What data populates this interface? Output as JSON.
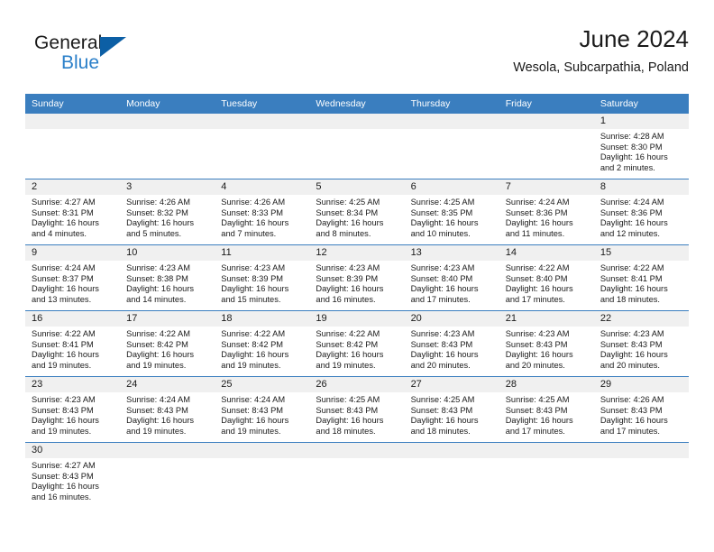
{
  "brand": {
    "name_part1": "General",
    "name_part2": "Blue",
    "logo_icon": "triangle-icon",
    "accent_color": "#0c5fa5",
    "secondary_color": "#2a7fc9"
  },
  "header": {
    "title": "June 2024",
    "subtitle": "Wesola, Subcarpathia, Poland"
  },
  "theme": {
    "header_bg": "#3a7ebf",
    "daynum_bg": "#f0f0f0",
    "row_divider": "#3a7ebf",
    "text": "#1a1a1a"
  },
  "columns": [
    "Sunday",
    "Monday",
    "Tuesday",
    "Wednesday",
    "Thursday",
    "Friday",
    "Saturday"
  ],
  "weeks": [
    [
      {
        "day": "",
        "empty": true
      },
      {
        "day": "",
        "empty": true
      },
      {
        "day": "",
        "empty": true
      },
      {
        "day": "",
        "empty": true
      },
      {
        "day": "",
        "empty": true
      },
      {
        "day": "",
        "empty": true
      },
      {
        "day": "1",
        "sunrise": "Sunrise: 4:28 AM",
        "sunset": "Sunset: 8:30 PM",
        "daylight1": "Daylight: 16 hours",
        "daylight2": "and 2 minutes."
      }
    ],
    [
      {
        "day": "2",
        "sunrise": "Sunrise: 4:27 AM",
        "sunset": "Sunset: 8:31 PM",
        "daylight1": "Daylight: 16 hours",
        "daylight2": "and 4 minutes."
      },
      {
        "day": "3",
        "sunrise": "Sunrise: 4:26 AM",
        "sunset": "Sunset: 8:32 PM",
        "daylight1": "Daylight: 16 hours",
        "daylight2": "and 5 minutes."
      },
      {
        "day": "4",
        "sunrise": "Sunrise: 4:26 AM",
        "sunset": "Sunset: 8:33 PM",
        "daylight1": "Daylight: 16 hours",
        "daylight2": "and 7 minutes."
      },
      {
        "day": "5",
        "sunrise": "Sunrise: 4:25 AM",
        "sunset": "Sunset: 8:34 PM",
        "daylight1": "Daylight: 16 hours",
        "daylight2": "and 8 minutes."
      },
      {
        "day": "6",
        "sunrise": "Sunrise: 4:25 AM",
        "sunset": "Sunset: 8:35 PM",
        "daylight1": "Daylight: 16 hours",
        "daylight2": "and 10 minutes."
      },
      {
        "day": "7",
        "sunrise": "Sunrise: 4:24 AM",
        "sunset": "Sunset: 8:36 PM",
        "daylight1": "Daylight: 16 hours",
        "daylight2": "and 11 minutes."
      },
      {
        "day": "8",
        "sunrise": "Sunrise: 4:24 AM",
        "sunset": "Sunset: 8:36 PM",
        "daylight1": "Daylight: 16 hours",
        "daylight2": "and 12 minutes."
      }
    ],
    [
      {
        "day": "9",
        "sunrise": "Sunrise: 4:24 AM",
        "sunset": "Sunset: 8:37 PM",
        "daylight1": "Daylight: 16 hours",
        "daylight2": "and 13 minutes."
      },
      {
        "day": "10",
        "sunrise": "Sunrise: 4:23 AM",
        "sunset": "Sunset: 8:38 PM",
        "daylight1": "Daylight: 16 hours",
        "daylight2": "and 14 minutes."
      },
      {
        "day": "11",
        "sunrise": "Sunrise: 4:23 AM",
        "sunset": "Sunset: 8:39 PM",
        "daylight1": "Daylight: 16 hours",
        "daylight2": "and 15 minutes."
      },
      {
        "day": "12",
        "sunrise": "Sunrise: 4:23 AM",
        "sunset": "Sunset: 8:39 PM",
        "daylight1": "Daylight: 16 hours",
        "daylight2": "and 16 minutes."
      },
      {
        "day": "13",
        "sunrise": "Sunrise: 4:23 AM",
        "sunset": "Sunset: 8:40 PM",
        "daylight1": "Daylight: 16 hours",
        "daylight2": "and 17 minutes."
      },
      {
        "day": "14",
        "sunrise": "Sunrise: 4:22 AM",
        "sunset": "Sunset: 8:40 PM",
        "daylight1": "Daylight: 16 hours",
        "daylight2": "and 17 minutes."
      },
      {
        "day": "15",
        "sunrise": "Sunrise: 4:22 AM",
        "sunset": "Sunset: 8:41 PM",
        "daylight1": "Daylight: 16 hours",
        "daylight2": "and 18 minutes."
      }
    ],
    [
      {
        "day": "16",
        "sunrise": "Sunrise: 4:22 AM",
        "sunset": "Sunset: 8:41 PM",
        "daylight1": "Daylight: 16 hours",
        "daylight2": "and 19 minutes."
      },
      {
        "day": "17",
        "sunrise": "Sunrise: 4:22 AM",
        "sunset": "Sunset: 8:42 PM",
        "daylight1": "Daylight: 16 hours",
        "daylight2": "and 19 minutes."
      },
      {
        "day": "18",
        "sunrise": "Sunrise: 4:22 AM",
        "sunset": "Sunset: 8:42 PM",
        "daylight1": "Daylight: 16 hours",
        "daylight2": "and 19 minutes."
      },
      {
        "day": "19",
        "sunrise": "Sunrise: 4:22 AM",
        "sunset": "Sunset: 8:42 PM",
        "daylight1": "Daylight: 16 hours",
        "daylight2": "and 19 minutes."
      },
      {
        "day": "20",
        "sunrise": "Sunrise: 4:23 AM",
        "sunset": "Sunset: 8:43 PM",
        "daylight1": "Daylight: 16 hours",
        "daylight2": "and 20 minutes."
      },
      {
        "day": "21",
        "sunrise": "Sunrise: 4:23 AM",
        "sunset": "Sunset: 8:43 PM",
        "daylight1": "Daylight: 16 hours",
        "daylight2": "and 20 minutes."
      },
      {
        "day": "22",
        "sunrise": "Sunrise: 4:23 AM",
        "sunset": "Sunset: 8:43 PM",
        "daylight1": "Daylight: 16 hours",
        "daylight2": "and 20 minutes."
      }
    ],
    [
      {
        "day": "23",
        "sunrise": "Sunrise: 4:23 AM",
        "sunset": "Sunset: 8:43 PM",
        "daylight1": "Daylight: 16 hours",
        "daylight2": "and 19 minutes."
      },
      {
        "day": "24",
        "sunrise": "Sunrise: 4:24 AM",
        "sunset": "Sunset: 8:43 PM",
        "daylight1": "Daylight: 16 hours",
        "daylight2": "and 19 minutes."
      },
      {
        "day": "25",
        "sunrise": "Sunrise: 4:24 AM",
        "sunset": "Sunset: 8:43 PM",
        "daylight1": "Daylight: 16 hours",
        "daylight2": "and 19 minutes."
      },
      {
        "day": "26",
        "sunrise": "Sunrise: 4:25 AM",
        "sunset": "Sunset: 8:43 PM",
        "daylight1": "Daylight: 16 hours",
        "daylight2": "and 18 minutes."
      },
      {
        "day": "27",
        "sunrise": "Sunrise: 4:25 AM",
        "sunset": "Sunset: 8:43 PM",
        "daylight1": "Daylight: 16 hours",
        "daylight2": "and 18 minutes."
      },
      {
        "day": "28",
        "sunrise": "Sunrise: 4:25 AM",
        "sunset": "Sunset: 8:43 PM",
        "daylight1": "Daylight: 16 hours",
        "daylight2": "and 17 minutes."
      },
      {
        "day": "29",
        "sunrise": "Sunrise: 4:26 AM",
        "sunset": "Sunset: 8:43 PM",
        "daylight1": "Daylight: 16 hours",
        "daylight2": "and 17 minutes."
      }
    ],
    [
      {
        "day": "30",
        "sunrise": "Sunrise: 4:27 AM",
        "sunset": "Sunset: 8:43 PM",
        "daylight1": "Daylight: 16 hours",
        "daylight2": "and 16 minutes."
      },
      {
        "day": "",
        "empty": true
      },
      {
        "day": "",
        "empty": true
      },
      {
        "day": "",
        "empty": true
      },
      {
        "day": "",
        "empty": true
      },
      {
        "day": "",
        "empty": true
      },
      {
        "day": "",
        "empty": true
      }
    ]
  ]
}
